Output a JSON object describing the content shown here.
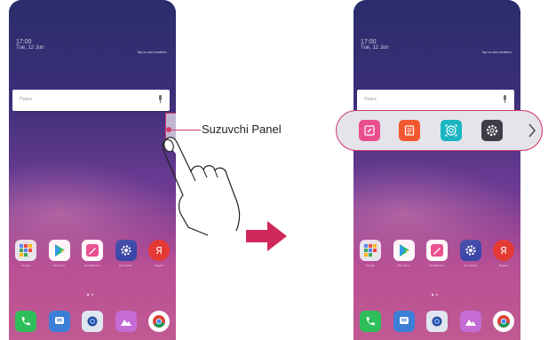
{
  "annotation": {
    "label": "Suzuvchi Panel",
    "accent_color": "#d43a6d"
  },
  "phone": {
    "clock_text": "17:00",
    "clock_sub": "Tue, 12 Jun",
    "weather_text": "Tap to add weather",
    "search_placeholder": "Поиск",
    "app_row1": [
      {
        "name": "Google",
        "icon": "folder-grid-icon",
        "color": "#e8e8ee"
      },
      {
        "name": "Play Store",
        "icon": "play-store-icon",
        "color": "#ffffff"
      },
      {
        "name": "QuickMemo+",
        "icon": "pencil-note-icon",
        "color": "#e84a8b"
      },
      {
        "name": "Настройки",
        "icon": "settings-gear-icon",
        "color": "#3a47a8"
      },
      {
        "name": "Яндекс",
        "icon": "yandex-icon",
        "color": "#e53935"
      }
    ],
    "app_row2": [
      {
        "name": "Phone",
        "icon": "phone-icon",
        "color": "#2fbf5a"
      },
      {
        "name": "Messages",
        "icon": "message-icon",
        "color": "#3b7fd6"
      },
      {
        "name": "Camera",
        "icon": "camera-icon",
        "color": "#dfe6f0"
      },
      {
        "name": "Gallery",
        "icon": "gallery-icon",
        "color": "#c56bd6"
      },
      {
        "name": "Chrome",
        "icon": "chrome-icon",
        "color": "#ffffff"
      }
    ]
  },
  "panel_items": [
    {
      "icon": "memo-edit-icon",
      "color": "#e94f8e"
    },
    {
      "icon": "calendar-list-icon",
      "color": "#f4572f"
    },
    {
      "icon": "face-scan-icon",
      "color": "#19b6c2"
    },
    {
      "icon": "settings-gear-icon",
      "color": "#3e3e48"
    }
  ]
}
